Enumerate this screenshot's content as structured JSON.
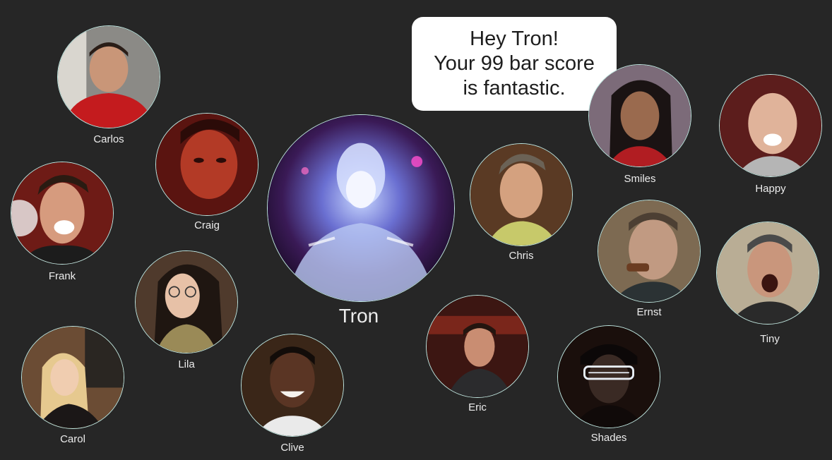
{
  "center": {
    "name": "Tron"
  },
  "speech_bubble": {
    "lines": [
      "Hey Tron!",
      "Your 99 bar score",
      "is fantastic."
    ]
  },
  "friends": [
    {
      "name": "Carlos"
    },
    {
      "name": "Craig"
    },
    {
      "name": "Frank"
    },
    {
      "name": "Lila"
    },
    {
      "name": "Carol"
    },
    {
      "name": "Clive"
    },
    {
      "name": "Chris"
    },
    {
      "name": "Eric"
    },
    {
      "name": "Smiles"
    },
    {
      "name": "Happy"
    },
    {
      "name": "Ernst"
    },
    {
      "name": "Tiny"
    },
    {
      "name": "Shades"
    }
  ],
  "colors": {
    "background": "#262626",
    "ring": "#bfe6e0",
    "bubble": "#ffffff",
    "label": "#ececec"
  }
}
